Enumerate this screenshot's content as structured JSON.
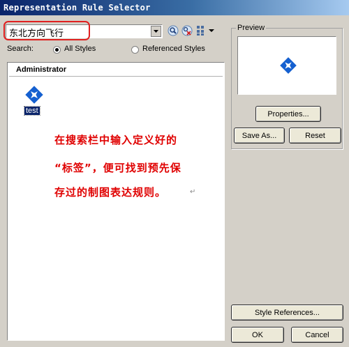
{
  "window": {
    "title": "Representation Rule Selector"
  },
  "search": {
    "value": "东北方向飞行",
    "label": "Search:",
    "options": {
      "all_styles": "All Styles",
      "referenced_styles": "Referenced Styles"
    },
    "selected": "All Styles"
  },
  "list": {
    "header": "Administrator",
    "items": [
      {
        "label": "test",
        "icon": "airplane-icon",
        "selected": true
      }
    ]
  },
  "annotation": {
    "lines": [
      "在搜索栏中输入定义好的",
      "“标签”，便可找到预先保",
      "存过的制图表达规则。"
    ],
    "color": "#e00000"
  },
  "preview": {
    "label": "Preview",
    "icon": "airplane-icon",
    "icon_color": "#1560d0"
  },
  "buttons": {
    "properties": "Properties...",
    "save_as": "Save As...",
    "reset": "Reset",
    "style_references": "Style References...",
    "ok": "OK",
    "cancel": "Cancel"
  }
}
